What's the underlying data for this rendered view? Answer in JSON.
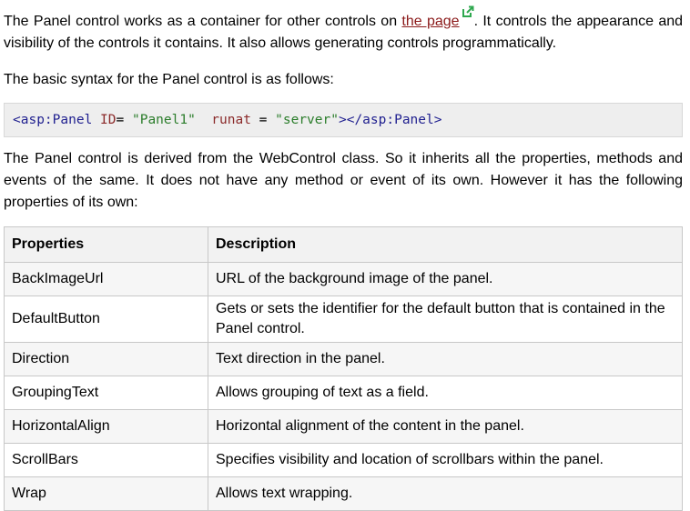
{
  "intro": {
    "before_link": "The Panel control works as a container for other controls on ",
    "link_text": "the page",
    "after_link": ". It controls the appearance and visibility of the controls it contains. It also allows generating controls programmatically."
  },
  "syntax_label": "The basic syntax for the Panel control is as follows:",
  "code": {
    "tag_open": "<asp:Panel",
    "attr_id": " ID",
    "eq1": "= ",
    "val_id": "\"Panel1\"",
    "attr_runat": "  runat",
    "eq2": " = ",
    "val_runat": "\"server\"",
    "close": "></asp:Panel>"
  },
  "derived_text": "The Panel control is derived from the WebControl class. So it inherits all the properties, methods and events of the same. It does not have any method or event of its own. However it has the following properties of its own:",
  "table": {
    "headers": {
      "property": "Properties",
      "description": "Description"
    },
    "rows": [
      {
        "property": "BackImageUrl",
        "description": "URL of the background image of the panel."
      },
      {
        "property": "DefaultButton",
        "description": "Gets or sets the identifier for the default button that is contained in the Panel control."
      },
      {
        "property": "Direction",
        "description": "Text direction in the panel."
      },
      {
        "property": "GroupingText",
        "description": "Allows grouping of text as a field."
      },
      {
        "property": "HorizontalAlign",
        "description": "Horizontal alignment of the content in the panel."
      },
      {
        "property": "ScrollBars",
        "description": "Specifies visibility and location of scrollbars within the panel."
      },
      {
        "property": "Wrap",
        "description": "Allows text wrapping."
      }
    ]
  },
  "colors": {
    "link": "#8b1a1a",
    "code_bg": "#eeeeee",
    "icon": "#2fa84f",
    "code_string": "#2b7d2b",
    "code_tag": "#1f1f8f"
  },
  "icons": {
    "external_link": "external-link-icon"
  }
}
